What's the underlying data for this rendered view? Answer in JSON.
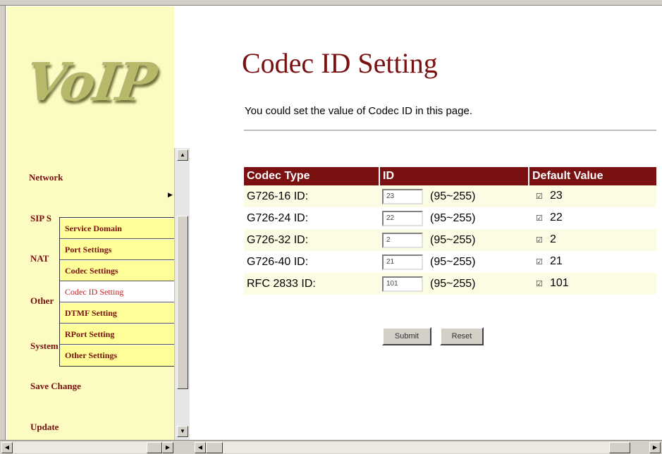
{
  "logo_text": "VoIP",
  "nav": {
    "items": [
      {
        "label": "Network"
      },
      {
        "label": "SIP S"
      },
      {
        "label": "NAT"
      },
      {
        "label": "Other"
      },
      {
        "label": "System"
      },
      {
        "label": "Save Change"
      },
      {
        "label": "Update"
      }
    ],
    "submenu": [
      {
        "label": "Service Domain"
      },
      {
        "label": "Port Settings"
      },
      {
        "label": "Codec Settings"
      },
      {
        "label": "Codec ID Setting",
        "active": true
      },
      {
        "label": "DTMF Setting"
      },
      {
        "label": "RPort Setting"
      },
      {
        "label": "Other Settings"
      }
    ]
  },
  "page": {
    "title": "Codec ID Setting",
    "description": "You could set the value of Codec ID in this page."
  },
  "table": {
    "headers": [
      "Codec Type",
      "ID",
      "Default Value"
    ],
    "rows": [
      {
        "type": "G726-16 ID:",
        "id": "23",
        "range": "(95~255)",
        "default": "23",
        "checked": true
      },
      {
        "type": "G726-24 ID:",
        "id": "22",
        "range": "(95~255)",
        "default": "22",
        "checked": true
      },
      {
        "type": "G726-32 ID:",
        "id": "2",
        "range": "(95~255)",
        "default": "2",
        "checked": true
      },
      {
        "type": "G726-40 ID:",
        "id": "21",
        "range": "(95~255)",
        "default": "21",
        "checked": true
      },
      {
        "type": "RFC 2833 ID:",
        "id": "101",
        "range": "(95~255)",
        "default": "101",
        "checked": true
      }
    ]
  },
  "buttons": {
    "submit": "Submit",
    "reset": "Reset"
  },
  "colors": {
    "accent": "#7a1010",
    "sidebar_bg": "#fcfcc2",
    "submenu_bg": "#ffff99"
  }
}
